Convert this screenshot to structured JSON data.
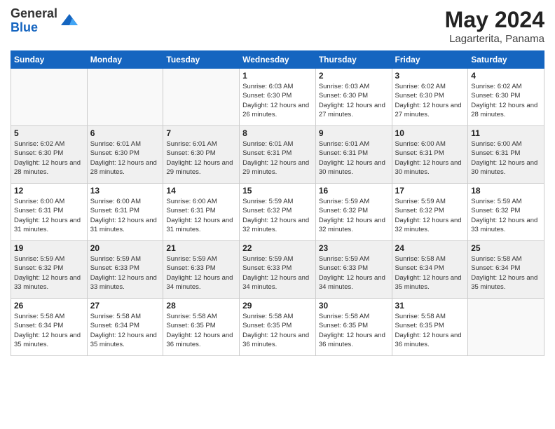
{
  "logo": {
    "general": "General",
    "blue": "Blue"
  },
  "title": "May 2024",
  "subtitle": "Lagarterita, Panama",
  "days_of_week": [
    "Sunday",
    "Monday",
    "Tuesday",
    "Wednesday",
    "Thursday",
    "Friday",
    "Saturday"
  ],
  "weeks": [
    [
      {
        "day": "",
        "sunrise": "",
        "sunset": "",
        "daylight": ""
      },
      {
        "day": "",
        "sunrise": "",
        "sunset": "",
        "daylight": ""
      },
      {
        "day": "",
        "sunrise": "",
        "sunset": "",
        "daylight": ""
      },
      {
        "day": "1",
        "sunrise": "Sunrise: 6:03 AM",
        "sunset": "Sunset: 6:30 PM",
        "daylight": "Daylight: 12 hours and 26 minutes."
      },
      {
        "day": "2",
        "sunrise": "Sunrise: 6:03 AM",
        "sunset": "Sunset: 6:30 PM",
        "daylight": "Daylight: 12 hours and 27 minutes."
      },
      {
        "day": "3",
        "sunrise": "Sunrise: 6:02 AM",
        "sunset": "Sunset: 6:30 PM",
        "daylight": "Daylight: 12 hours and 27 minutes."
      },
      {
        "day": "4",
        "sunrise": "Sunrise: 6:02 AM",
        "sunset": "Sunset: 6:30 PM",
        "daylight": "Daylight: 12 hours and 28 minutes."
      }
    ],
    [
      {
        "day": "5",
        "sunrise": "Sunrise: 6:02 AM",
        "sunset": "Sunset: 6:30 PM",
        "daylight": "Daylight: 12 hours and 28 minutes."
      },
      {
        "day": "6",
        "sunrise": "Sunrise: 6:01 AM",
        "sunset": "Sunset: 6:30 PM",
        "daylight": "Daylight: 12 hours and 28 minutes."
      },
      {
        "day": "7",
        "sunrise": "Sunrise: 6:01 AM",
        "sunset": "Sunset: 6:30 PM",
        "daylight": "Daylight: 12 hours and 29 minutes."
      },
      {
        "day": "8",
        "sunrise": "Sunrise: 6:01 AM",
        "sunset": "Sunset: 6:31 PM",
        "daylight": "Daylight: 12 hours and 29 minutes."
      },
      {
        "day": "9",
        "sunrise": "Sunrise: 6:01 AM",
        "sunset": "Sunset: 6:31 PM",
        "daylight": "Daylight: 12 hours and 30 minutes."
      },
      {
        "day": "10",
        "sunrise": "Sunrise: 6:00 AM",
        "sunset": "Sunset: 6:31 PM",
        "daylight": "Daylight: 12 hours and 30 minutes."
      },
      {
        "day": "11",
        "sunrise": "Sunrise: 6:00 AM",
        "sunset": "Sunset: 6:31 PM",
        "daylight": "Daylight: 12 hours and 30 minutes."
      }
    ],
    [
      {
        "day": "12",
        "sunrise": "Sunrise: 6:00 AM",
        "sunset": "Sunset: 6:31 PM",
        "daylight": "Daylight: 12 hours and 31 minutes."
      },
      {
        "day": "13",
        "sunrise": "Sunrise: 6:00 AM",
        "sunset": "Sunset: 6:31 PM",
        "daylight": "Daylight: 12 hours and 31 minutes."
      },
      {
        "day": "14",
        "sunrise": "Sunrise: 6:00 AM",
        "sunset": "Sunset: 6:31 PM",
        "daylight": "Daylight: 12 hours and 31 minutes."
      },
      {
        "day": "15",
        "sunrise": "Sunrise: 5:59 AM",
        "sunset": "Sunset: 6:32 PM",
        "daylight": "Daylight: 12 hours and 32 minutes."
      },
      {
        "day": "16",
        "sunrise": "Sunrise: 5:59 AM",
        "sunset": "Sunset: 6:32 PM",
        "daylight": "Daylight: 12 hours and 32 minutes."
      },
      {
        "day": "17",
        "sunrise": "Sunrise: 5:59 AM",
        "sunset": "Sunset: 6:32 PM",
        "daylight": "Daylight: 12 hours and 32 minutes."
      },
      {
        "day": "18",
        "sunrise": "Sunrise: 5:59 AM",
        "sunset": "Sunset: 6:32 PM",
        "daylight": "Daylight: 12 hours and 33 minutes."
      }
    ],
    [
      {
        "day": "19",
        "sunrise": "Sunrise: 5:59 AM",
        "sunset": "Sunset: 6:32 PM",
        "daylight": "Daylight: 12 hours and 33 minutes."
      },
      {
        "day": "20",
        "sunrise": "Sunrise: 5:59 AM",
        "sunset": "Sunset: 6:33 PM",
        "daylight": "Daylight: 12 hours and 33 minutes."
      },
      {
        "day": "21",
        "sunrise": "Sunrise: 5:59 AM",
        "sunset": "Sunset: 6:33 PM",
        "daylight": "Daylight: 12 hours and 34 minutes."
      },
      {
        "day": "22",
        "sunrise": "Sunrise: 5:59 AM",
        "sunset": "Sunset: 6:33 PM",
        "daylight": "Daylight: 12 hours and 34 minutes."
      },
      {
        "day": "23",
        "sunrise": "Sunrise: 5:59 AM",
        "sunset": "Sunset: 6:33 PM",
        "daylight": "Daylight: 12 hours and 34 minutes."
      },
      {
        "day": "24",
        "sunrise": "Sunrise: 5:58 AM",
        "sunset": "Sunset: 6:34 PM",
        "daylight": "Daylight: 12 hours and 35 minutes."
      },
      {
        "day": "25",
        "sunrise": "Sunrise: 5:58 AM",
        "sunset": "Sunset: 6:34 PM",
        "daylight": "Daylight: 12 hours and 35 minutes."
      }
    ],
    [
      {
        "day": "26",
        "sunrise": "Sunrise: 5:58 AM",
        "sunset": "Sunset: 6:34 PM",
        "daylight": "Daylight: 12 hours and 35 minutes."
      },
      {
        "day": "27",
        "sunrise": "Sunrise: 5:58 AM",
        "sunset": "Sunset: 6:34 PM",
        "daylight": "Daylight: 12 hours and 35 minutes."
      },
      {
        "day": "28",
        "sunrise": "Sunrise: 5:58 AM",
        "sunset": "Sunset: 6:35 PM",
        "daylight": "Daylight: 12 hours and 36 minutes."
      },
      {
        "day": "29",
        "sunrise": "Sunrise: 5:58 AM",
        "sunset": "Sunset: 6:35 PM",
        "daylight": "Daylight: 12 hours and 36 minutes."
      },
      {
        "day": "30",
        "sunrise": "Sunrise: 5:58 AM",
        "sunset": "Sunset: 6:35 PM",
        "daylight": "Daylight: 12 hours and 36 minutes."
      },
      {
        "day": "31",
        "sunrise": "Sunrise: 5:58 AM",
        "sunset": "Sunset: 6:35 PM",
        "daylight": "Daylight: 12 hours and 36 minutes."
      },
      {
        "day": "",
        "sunrise": "",
        "sunset": "",
        "daylight": ""
      }
    ]
  ]
}
